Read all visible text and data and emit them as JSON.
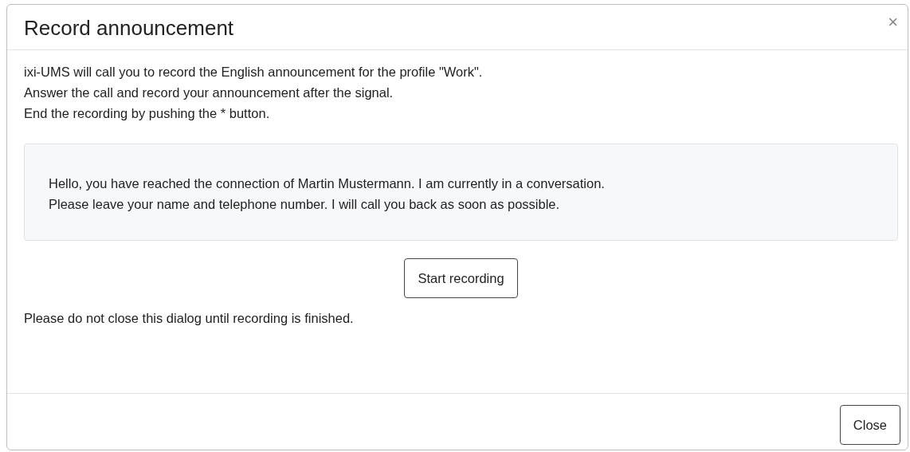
{
  "dialog": {
    "title": "Record announcement",
    "close_icon": "×",
    "instructions": [
      "ixi-UMS will call you to record the English announcement for the profile \"Work\".",
      "Answer the call and record your announcement after the signal.",
      "End the recording by pushing the * button."
    ],
    "announcement": [
      "Hello, you have reached the connection of Martin Mustermann. I am currently in a conversation.",
      "Please leave your name and telephone number. I will call you back as soon as possible."
    ],
    "record_button": "Start recording",
    "note": "Please do not close this dialog until recording is finished.",
    "footer_button": "Close"
  }
}
